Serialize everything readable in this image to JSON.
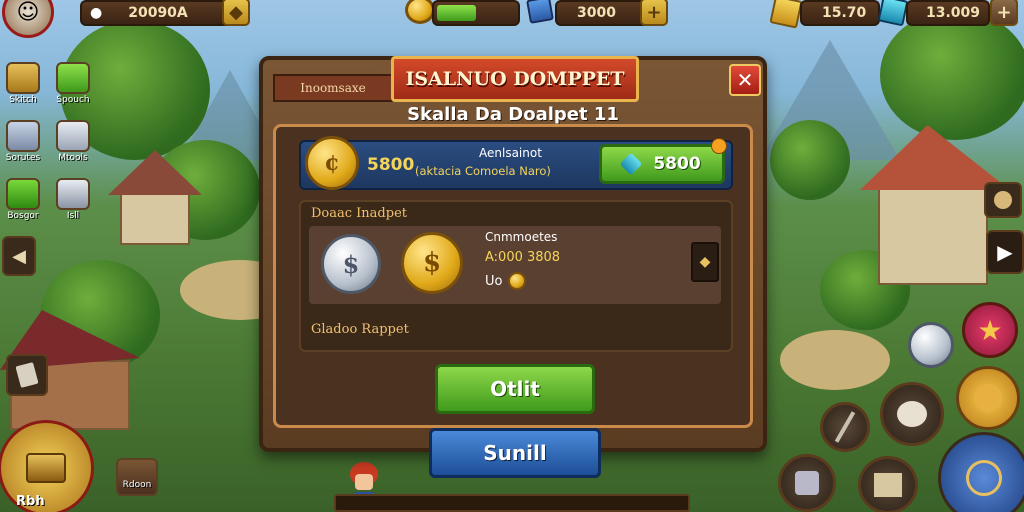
{
  "hud": {
    "player_score": "20090A",
    "energy_value": "3000",
    "gold_value": "15.70",
    "gem_value": "13.009",
    "energy_fill": 0.5
  },
  "left_menu": {
    "items": [
      {
        "label": "Skitch"
      },
      {
        "label": "Spouch"
      },
      {
        "label": "Sorutes"
      },
      {
        "label": "Mtools"
      },
      {
        "label": "Bosgor"
      },
      {
        "label": "Isll"
      }
    ],
    "bottom_label": "Rbh",
    "bottom_item_label": "Rdoon"
  },
  "modal": {
    "tab_label": "Inoomsaxe",
    "title": "ISALNUO DOMPPET",
    "subtitle": "Skalla Da Doalpet 11",
    "close_label": "✕",
    "offer": {
      "amount": "5800",
      "heading": "Aenlsainot",
      "description": "(aktacia Comoela Naro)",
      "button_label": "5800"
    },
    "details": {
      "header": "Doaac Inadpet",
      "card_title": "Cnmmoetes",
      "card_value": "A:000 3808",
      "card_extra": "Uo",
      "footer": "Gladoo Rappet"
    },
    "ok_label": "Otlit",
    "submit_label": "Sunill"
  },
  "colors": {
    "accent_red": "#c43a20",
    "accent_gold": "#e0a919",
    "accent_green": "#5fbf2a",
    "accent_blue": "#2a62b2"
  }
}
